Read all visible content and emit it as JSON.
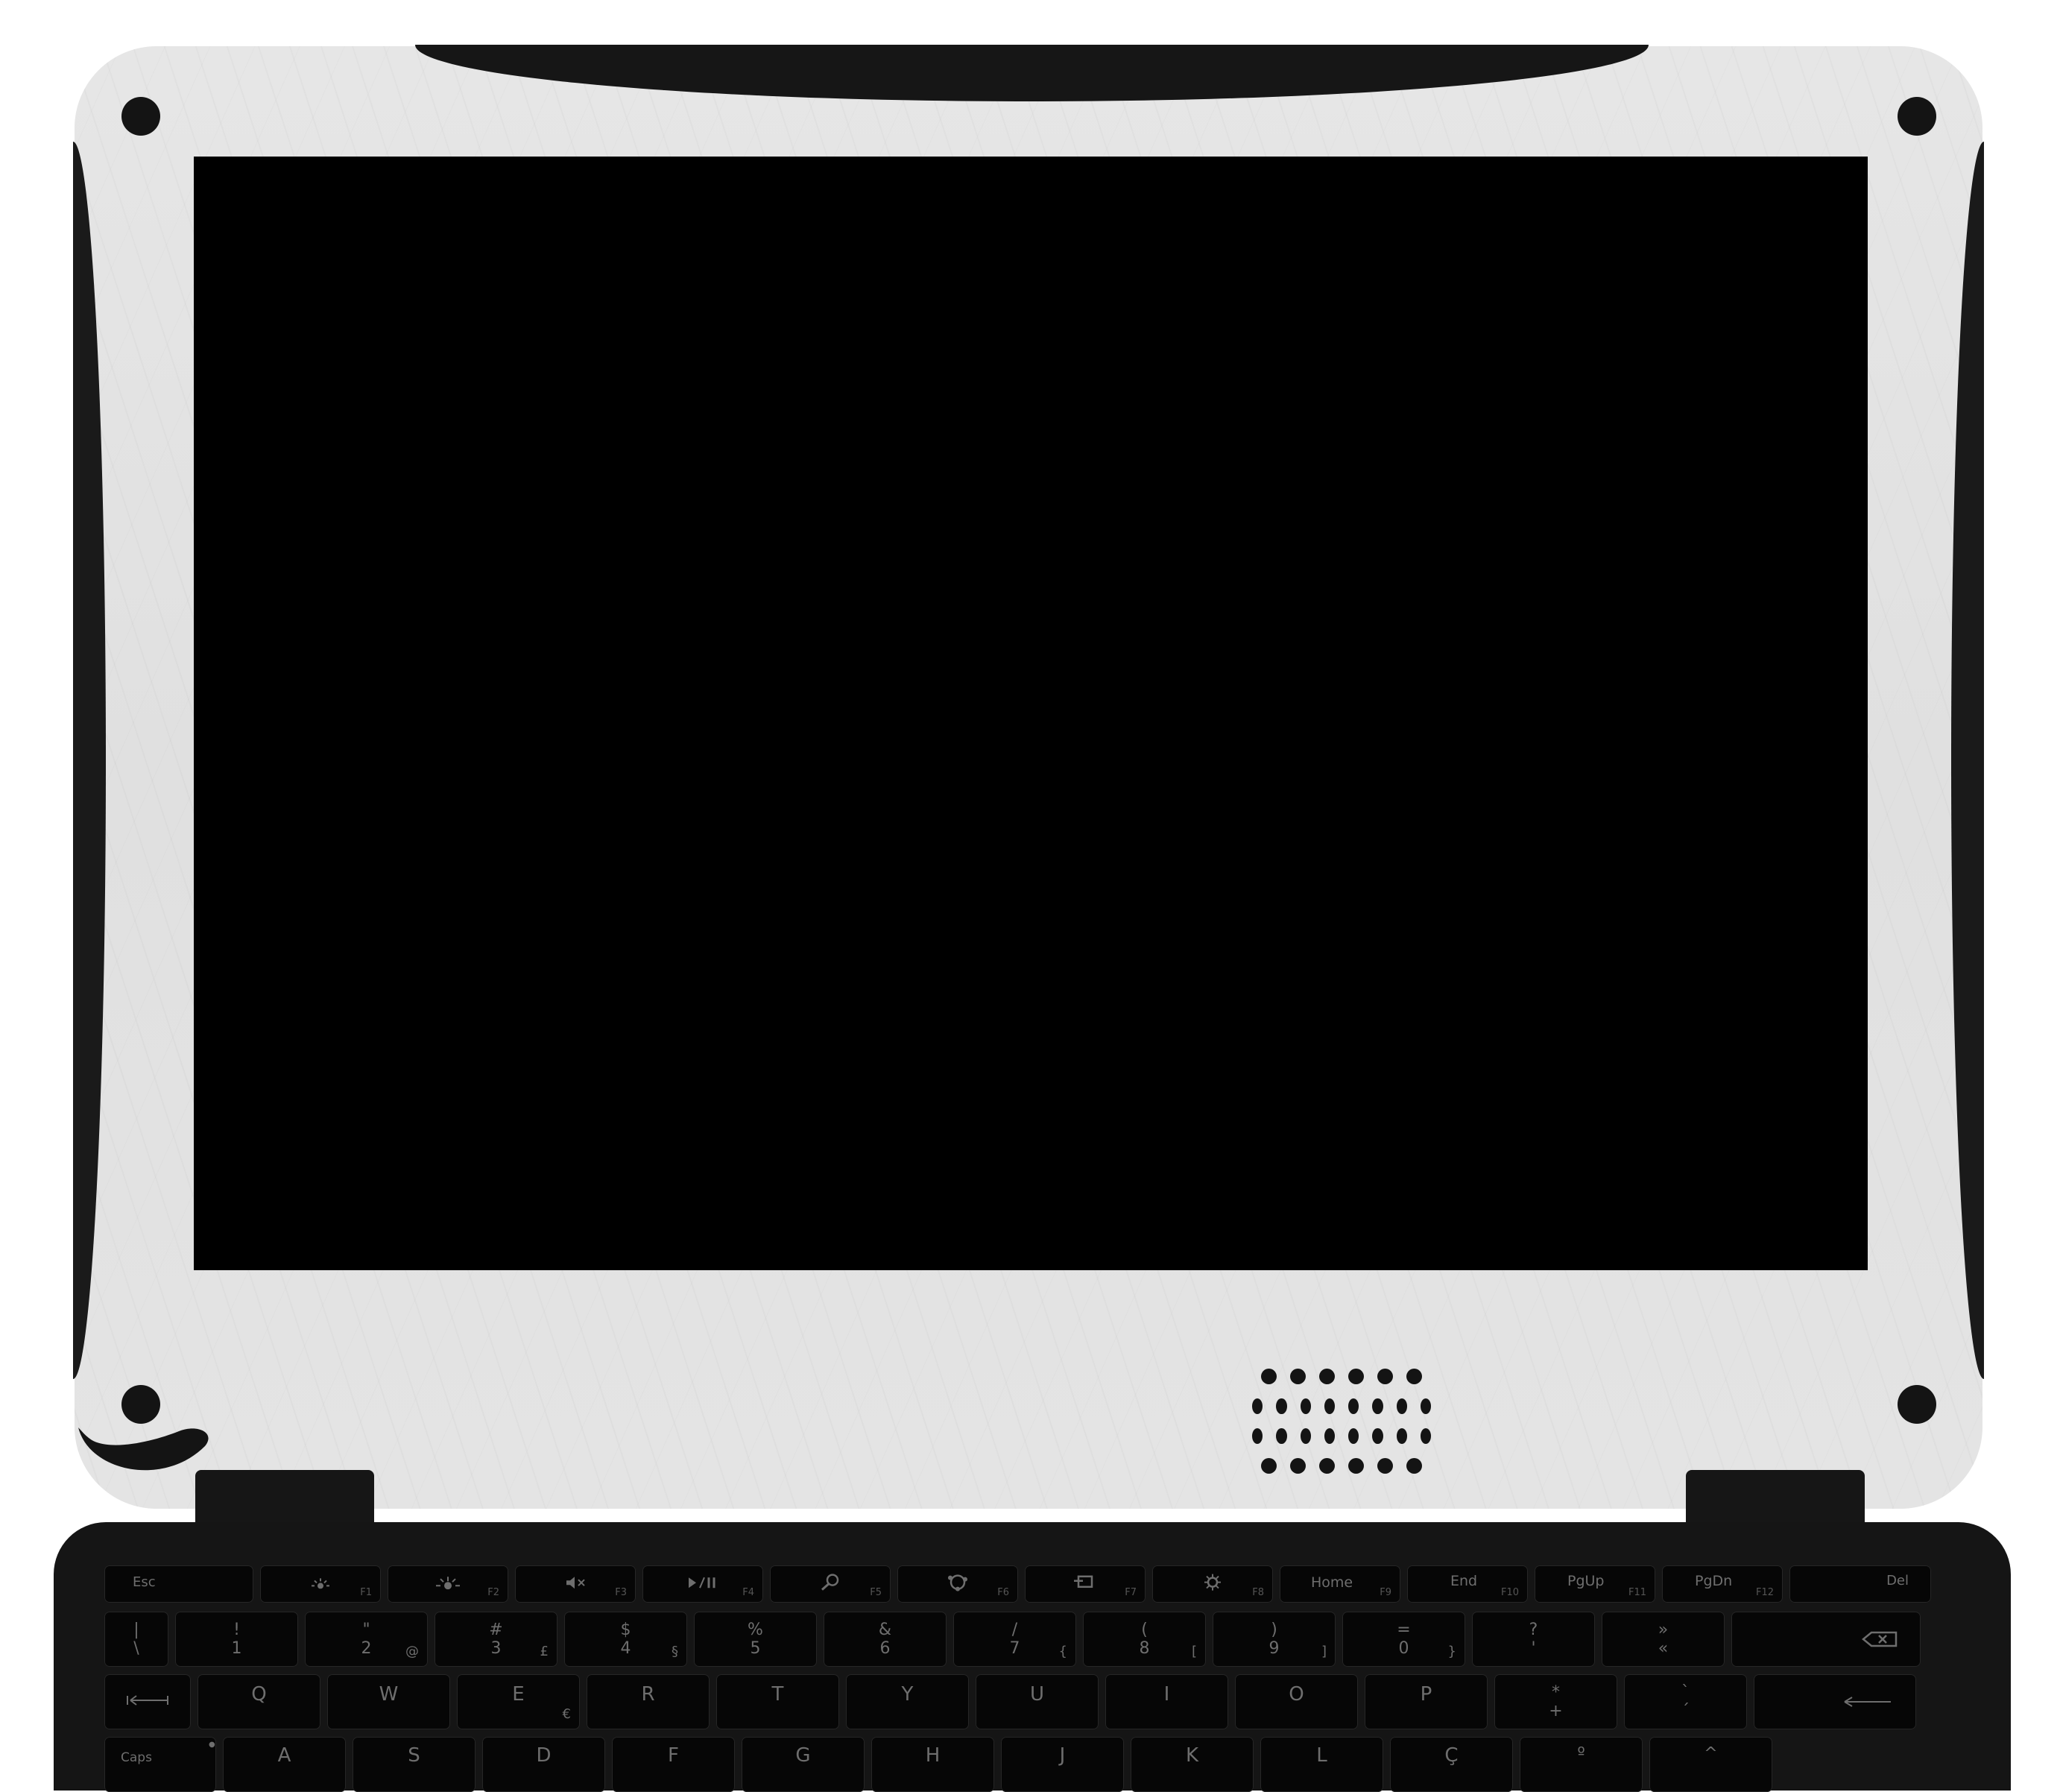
{
  "device": {
    "bezel_color": "#e2e2e2",
    "trim_color": "#161616",
    "screen_color": "#000000"
  },
  "keyboard": {
    "function_row": [
      {
        "label": "Esc",
        "fn": "",
        "icon": ""
      },
      {
        "label": "",
        "fn": "F1",
        "icon": "brightness-down-icon"
      },
      {
        "label": "",
        "fn": "F2",
        "icon": "brightness-up-icon"
      },
      {
        "label": "",
        "fn": "F3",
        "icon": "mute-icon"
      },
      {
        "label": "",
        "fn": "F4",
        "icon": "play-pause-icon"
      },
      {
        "label": "",
        "fn": "F5",
        "icon": "search-icon"
      },
      {
        "label": "",
        "fn": "F6",
        "icon": "share-icon"
      },
      {
        "label": "",
        "fn": "F7",
        "icon": "devices-icon"
      },
      {
        "label": "",
        "fn": "F8",
        "icon": "settings-icon"
      },
      {
        "label": "Home",
        "fn": "F9",
        "icon": ""
      },
      {
        "label": "End",
        "fn": "F10",
        "icon": ""
      },
      {
        "label": "PgUp",
        "fn": "F11",
        "icon": ""
      },
      {
        "label": "PgDn",
        "fn": "F12",
        "icon": ""
      },
      {
        "label": "Del",
        "fn": "",
        "icon": ""
      }
    ],
    "number_row": [
      {
        "top": "|",
        "bottom": "\\",
        "alt": ""
      },
      {
        "top": "!",
        "bottom": "1",
        "alt": ""
      },
      {
        "top": "\"",
        "bottom": "2",
        "alt": "@"
      },
      {
        "top": "#",
        "bottom": "3",
        "alt": "£"
      },
      {
        "top": "$",
        "bottom": "4",
        "alt": "§"
      },
      {
        "top": "%",
        "bottom": "5",
        "alt": ""
      },
      {
        "top": "&",
        "bottom": "6",
        "alt": ""
      },
      {
        "top": "/",
        "bottom": "7",
        "alt": "{"
      },
      {
        "top": "(",
        "bottom": "8",
        "alt": "["
      },
      {
        "top": ")",
        "bottom": "9",
        "alt": "]"
      },
      {
        "top": "=",
        "bottom": "0",
        "alt": "}"
      },
      {
        "top": "?",
        "bottom": "'",
        "alt": ""
      },
      {
        "top": "»",
        "bottom": "«",
        "alt": ""
      }
    ],
    "backspace_icon": "backspace-icon",
    "tab_icon": "tab-icon",
    "qwerty_row": [
      {
        "label": "Q",
        "alt": ""
      },
      {
        "label": "W",
        "alt": ""
      },
      {
        "label": "E",
        "alt": "€"
      },
      {
        "label": "R",
        "alt": ""
      },
      {
        "label": "T",
        "alt": ""
      },
      {
        "label": "Y",
        "alt": ""
      },
      {
        "label": "U",
        "alt": ""
      },
      {
        "label": "I",
        "alt": ""
      },
      {
        "label": "O",
        "alt": ""
      },
      {
        "label": "P",
        "alt": ""
      },
      {
        "label": "*",
        "alt": "+"
      },
      {
        "label": "`",
        "alt": "´"
      }
    ],
    "enter_icon": "enter-icon",
    "caps_label": "Caps",
    "home_row": [
      {
        "label": "A"
      },
      {
        "label": "S"
      },
      {
        "label": "D"
      },
      {
        "label": "F"
      },
      {
        "label": "G"
      },
      {
        "label": "H"
      },
      {
        "label": "J"
      },
      {
        "label": "K"
      },
      {
        "label": "L"
      },
      {
        "label": "Ç"
      },
      {
        "label": "º"
      },
      {
        "label": "^"
      }
    ]
  }
}
